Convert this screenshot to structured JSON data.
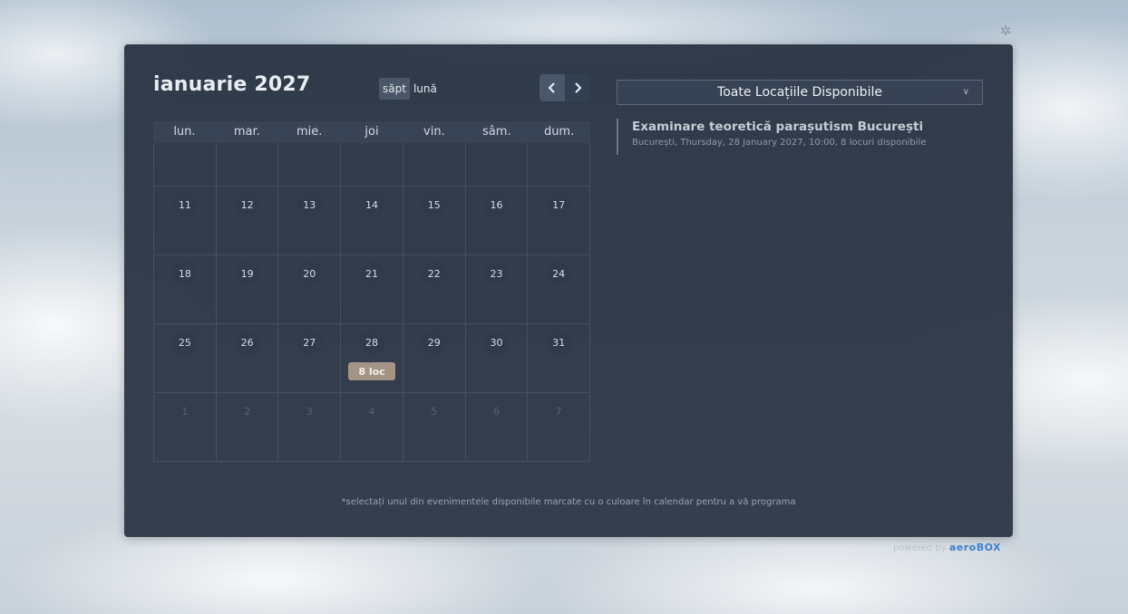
{
  "settings_icon": "gear-icon",
  "header": {
    "month_title": "ianuarie 2027",
    "view_week": "săpt",
    "view_month": "lună",
    "prev_icon": "chevron-left-icon",
    "next_icon": "chevron-right-icon"
  },
  "calendar": {
    "weekdays": [
      "lun.",
      "mar.",
      "mie.",
      "joi",
      "vin.",
      "sâm.",
      "dum."
    ],
    "weeks": [
      [
        "",
        "",
        "",
        "",
        "",
        "",
        ""
      ],
      [
        "11",
        "12",
        "13",
        "14",
        "15",
        "16",
        "17"
      ],
      [
        "18",
        "19",
        "20",
        "21",
        "22",
        "23",
        "24"
      ],
      [
        "25",
        "26",
        "27",
        "28",
        "29",
        "30",
        "31"
      ],
      [
        "1",
        "2",
        "3",
        "4",
        "5",
        "6",
        "7"
      ]
    ],
    "event_badge": {
      "day": "28",
      "label": "8 loc",
      "color": "#a49486"
    }
  },
  "location_filter": {
    "selected": "Toate Locațiile Disponibile",
    "icon": "chevron-down-icon"
  },
  "event": {
    "title": "Examinare teoretică parașutism București",
    "detail": "București, Thursday, 28 January 2027, 10:00, 8 locuri disponibile"
  },
  "footer_note": "*selectați unul din evenimentele disponibile marcate cu o culoare în calendar pentru a vă programa",
  "powered": {
    "prefix": "powered by",
    "brand": "aeroBOX"
  }
}
